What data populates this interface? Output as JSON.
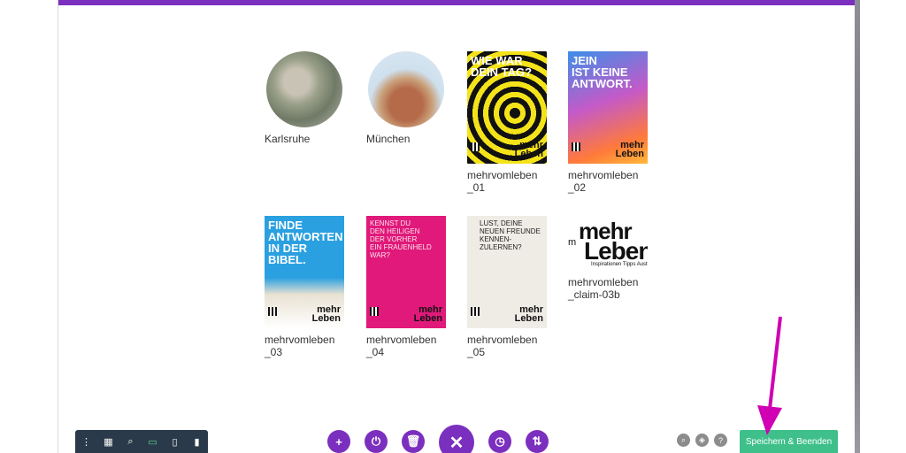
{
  "colors": {
    "accent": "#7b2fbe",
    "toolbar_bg": "#2b3a4a",
    "save_bg": "#3fc08b",
    "annotation_arrow": "#d100b4"
  },
  "gallery": {
    "tiles": [
      {
        "caption": "Karlsruhe",
        "kind": "photo-circle",
        "icon": "city-aerial-photo"
      },
      {
        "caption": "München",
        "kind": "photo-circle",
        "icon": "church-towers-photo"
      },
      {
        "caption": "mehrvomleben\n_01",
        "kind": "poster",
        "poster_text": "WIE WAR\nDEIN TAG?",
        "bg": "#f5e31a",
        "fg": "#ffffff"
      },
      {
        "caption": "mehrvomleben\n_02",
        "kind": "poster",
        "poster_text": "JEIN\nIST KEINE\nANTWORT.",
        "bg": "#e35a8a",
        "fg": "#ffffff"
      },
      {
        "caption": "mehrvomleben\n_03",
        "kind": "poster",
        "poster_text": "FINDE\nANTWORTEN\nIN DER\nBIBEL.",
        "bg": "#2aa0e0",
        "fg": "#ffffff"
      },
      {
        "caption": "mehrvomleben\n_04",
        "kind": "poster",
        "poster_text": "KENNST DU\nDEN HEILIGEN\nDER VORHER\nEIN FRAUENHELD\nWAR?",
        "bg": "#e0197a",
        "fg": "#ffe3ee"
      },
      {
        "caption": "mehrvomleben\n_05",
        "kind": "poster",
        "poster_text": "LUST, DEINE\nNEUEN FREUNDE\nKENNEN-\nZULERNEN?",
        "bg": "#efece6",
        "fg": "#222222"
      },
      {
        "caption": "mehrvomleben\n_claim-03b",
        "kind": "claim",
        "claim_word1": "mehr",
        "claim_word0": "m",
        "claim_word2": "Leben",
        "claim_tagline": "Inspirationen Tipps Aust"
      }
    ],
    "poster_brand": "mehr\nLeben"
  },
  "toolbar": {
    "buttons": [
      {
        "name": "more-options-icon",
        "glyph": "⋮"
      },
      {
        "name": "layout-icon",
        "glyph": "▦"
      },
      {
        "name": "zoom-icon",
        "glyph": "⌕"
      },
      {
        "name": "desktop-view-icon",
        "glyph": "▭"
      },
      {
        "name": "tablet-view-icon",
        "glyph": "▯"
      },
      {
        "name": "phone-view-icon",
        "glyph": "▮"
      }
    ],
    "active_index": 3
  },
  "actions": [
    {
      "name": "add-button",
      "glyph": "+"
    },
    {
      "name": "power-button",
      "glyph": "⏻"
    },
    {
      "name": "delete-button",
      "glyph": "🗑"
    },
    {
      "name": "close-button",
      "glyph": "✕"
    },
    {
      "name": "history-button",
      "glyph": "◷"
    },
    {
      "name": "sort-button",
      "glyph": "⇅"
    }
  ],
  "help": [
    {
      "name": "search-icon",
      "glyph": "⌕"
    },
    {
      "name": "layers-icon",
      "glyph": "◈"
    },
    {
      "name": "help-icon",
      "glyph": "?"
    }
  ],
  "save_label": "Speichern & Beenden",
  "topbar_close": "×"
}
